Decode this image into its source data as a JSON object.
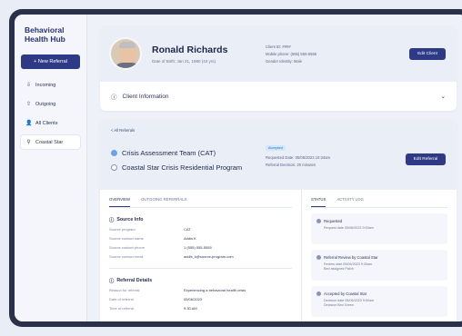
{
  "sidebar": {
    "brand_line1": "Behavioral",
    "brand_line2": "Health Hub",
    "new_referral": "+ New Referral",
    "items": [
      {
        "label": "Incoming",
        "icon": "inbox-icon",
        "glyph": "⇩"
      },
      {
        "label": "Outgoing",
        "icon": "outbox-icon",
        "glyph": "⇧"
      },
      {
        "label": "All Clients",
        "icon": "people-icon",
        "glyph": "👤"
      },
      {
        "label": "Coastal Star",
        "icon": "location-pin-icon",
        "glyph": "⚲"
      }
    ]
  },
  "client": {
    "name": "Ronald Richards",
    "dob": "Date of Birth: Jan 21, 1980 (43 yrs)",
    "meta_id": "Client ID: ####",
    "meta_phone": "Mobile phone: (555) 555-5555",
    "meta_gender": "Gender Identity: Male",
    "edit_button": "Edit Client",
    "info_section": "Client Information"
  },
  "referral": {
    "all_referrals": "< All Referrals",
    "primary": "Crisis Assessment Team (CAT)",
    "secondary": "Coastal Star Crisis Residential Program",
    "status_tag": "Accepted",
    "requested_date": "Requested Date:   05/06/2023   10:34am",
    "decision": "Referral Decision:   20 minutes",
    "edit_button": "Edit Referral"
  },
  "tabs": {
    "overview": "OVERVIEW",
    "outgoing": "OUTGOING REFERRALS",
    "status": "STATUS",
    "activity": "ACTIVITY LOG"
  },
  "source_info": {
    "title": "Source Info",
    "rows": [
      {
        "k": "Source program",
        "v": "CAT"
      },
      {
        "k": "Source contact name",
        "v": "Addis K"
      },
      {
        "k": "Source contact phone",
        "v": "1 (555) 555-5555"
      },
      {
        "k": "Source contact email",
        "v": "addis_k@source-program.com"
      }
    ]
  },
  "referral_details": {
    "title": "Referral Details",
    "rows": [
      {
        "k": "Reason for referral",
        "v": "Experiencing a behavioral health crisis"
      },
      {
        "k": "Date of referral",
        "v": "05/06/2023"
      },
      {
        "k": "Time of referral",
        "v": "9:30 AM"
      }
    ]
  },
  "status_log": [
    {
      "title": "Requested",
      "line1": "Request date   05/06/2023   9:30am",
      "line2": ""
    },
    {
      "title": "Referral Review by Coastal Star",
      "line1": "Review start   05/06/2023   9:30am",
      "line2": "Bed assigned   Patch"
    },
    {
      "title": "Accepted by Coastal Star",
      "line1": "Decision date   05/06/2023   9:50am",
      "line2": "Decision   Bed Green"
    }
  ]
}
